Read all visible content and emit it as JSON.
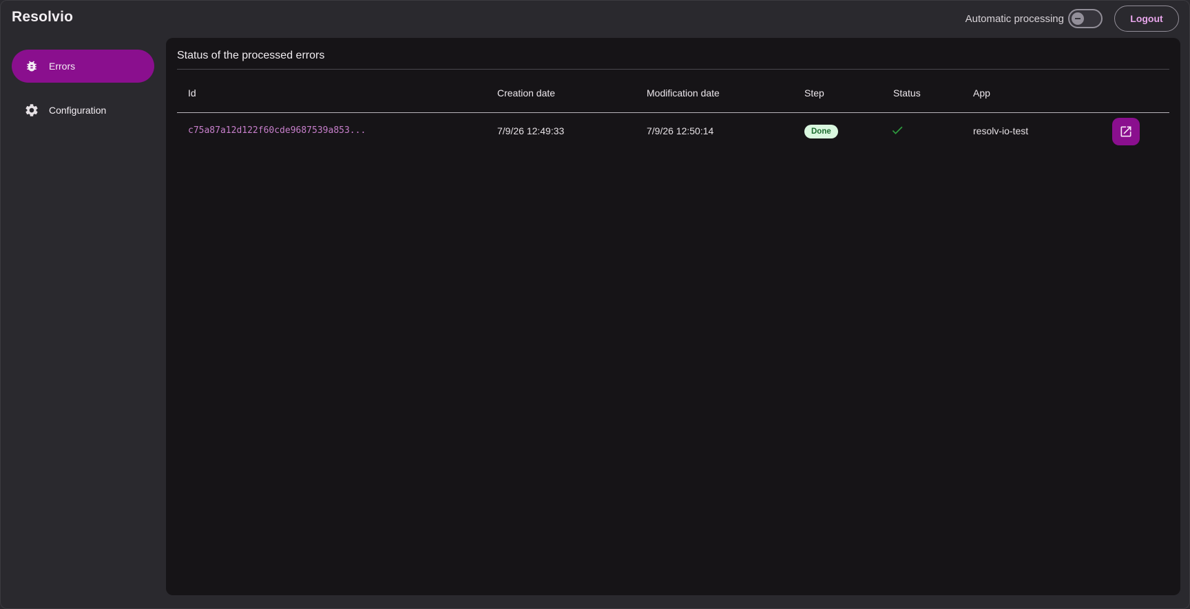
{
  "header": {
    "app_title": "Resolvio",
    "auto_processing_label": "Automatic processing",
    "auto_processing_enabled": false,
    "logout_label": "Logout"
  },
  "sidebar": {
    "items": [
      {
        "label": "Errors",
        "icon": "bug-icon",
        "active": true
      },
      {
        "label": "Configuration",
        "icon": "gear-icon",
        "active": false
      }
    ]
  },
  "main": {
    "title": "Status of the processed errors",
    "table": {
      "columns": [
        "Id",
        "Creation date",
        "Modification date",
        "Step",
        "Status",
        "App"
      ],
      "rows": [
        {
          "id": "c75a87a12d122f60cde9687539a853...",
          "creation_date": "7/9/26 12:49:33",
          "modification_date": "7/9/26 12:50:14",
          "step": "Done",
          "status": "check-icon",
          "app": "resolv-io-test",
          "action": "open-in-new-icon"
        }
      ]
    }
  },
  "colors": {
    "accent": "#8a0f8e",
    "background": "#2a292e",
    "panel": "#161417",
    "link": "#c77fcb",
    "success": "#2e9e3f",
    "badge_bg": "#d9f7df",
    "badge_text": "#1b6b2e"
  }
}
